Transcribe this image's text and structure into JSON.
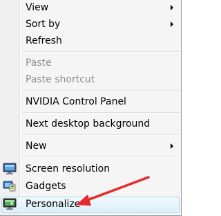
{
  "menu": {
    "view": "View",
    "sort_by": "Sort by",
    "refresh": "Refresh",
    "paste": "Paste",
    "paste_shortcut": "Paste shortcut",
    "nvidia": "NVIDIA Control Panel",
    "next_bg": "Next desktop background",
    "new": "New",
    "screen_resolution": "Screen resolution",
    "gadgets": "Gadgets",
    "personalize": "Personalize"
  },
  "icons": {
    "screen_resolution": "monitor-icon",
    "gadgets": "gadgets-icon",
    "personalize": "personalize-icon"
  },
  "colors": {
    "menu_bg": "#f5f5f5",
    "disabled_text": "#8d8d8d",
    "annotation_arrow": "#e32b2b",
    "highlight_border": "#a8d8eb"
  }
}
